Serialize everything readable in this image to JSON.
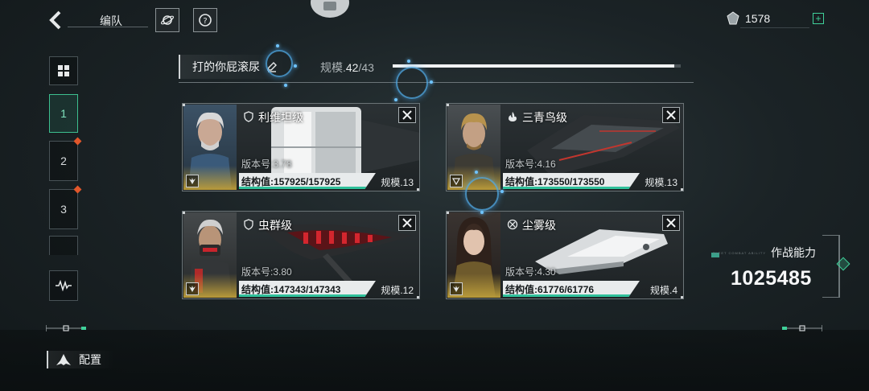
{
  "header": {
    "title": "编队",
    "currency_amount": "1578",
    "icons": [
      "back-arrow-icon",
      "planet-icon",
      "help-icon",
      "gem-icon",
      "plus-icon"
    ]
  },
  "rail": {
    "items": [
      {
        "label": "",
        "icon": "grid-icon"
      },
      {
        "label": "1",
        "active": true
      },
      {
        "label": "2",
        "notify": true
      },
      {
        "label": "3",
        "notify": true
      },
      {
        "label": "",
        "icon": "waveform-icon"
      }
    ]
  },
  "fleet": {
    "name": "打的你屁滚尿",
    "scale_label": "规模.",
    "scale_current": "42",
    "scale_total": "/43",
    "scale_progress": 0.977
  },
  "ships": [
    {
      "name": "利维坦级",
      "version": "版本号:3.78",
      "hp": "结构值:157925/157925",
      "hp_ratio": 1.0,
      "scale": "规模.13",
      "class_icon": "shield-icon",
      "role_icon": "wings-icon"
    },
    {
      "name": "三青鸟级",
      "version": "版本号:4.16",
      "hp": "结构值:173550/173550",
      "hp_ratio": 1.0,
      "scale": "规模.13",
      "class_icon": "flame-icon",
      "role_icon": "triangle-icon"
    },
    {
      "name": "虫群级",
      "version": "版本号:3.80",
      "hp": "结构值:147343/147343",
      "hp_ratio": 1.0,
      "scale": "规模.12",
      "class_icon": "shield-icon",
      "role_icon": "wings-icon"
    },
    {
      "name": "尘雾级",
      "version": "版本号:4.30",
      "hp": "结构值:61776/61776",
      "hp_ratio": 1.0,
      "scale": "规模.4",
      "class_icon": "crosshair-icon",
      "role_icon": "wings-icon"
    }
  ],
  "combat": {
    "label": "作战能力",
    "sub_label": "FLEET COMBAT ABILITY",
    "value": "1025485"
  },
  "footer": {
    "config_label": "配置"
  },
  "colors": {
    "accent_green": "#3fd19a",
    "hp_bar": "#2fc09a",
    "notify": "#e2572b",
    "tutorial_ring": "#50aae6"
  }
}
